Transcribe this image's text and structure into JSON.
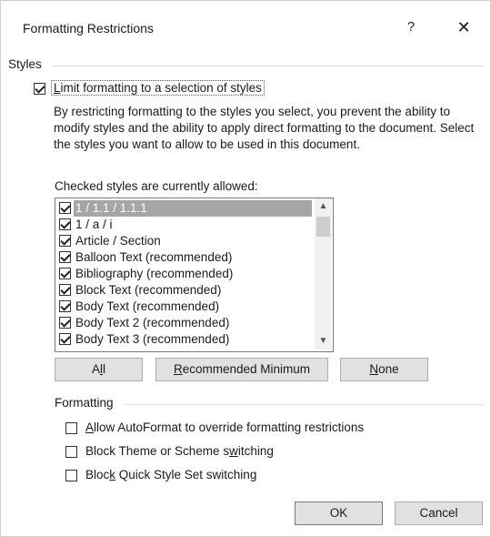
{
  "dialog": {
    "title": "Formatting Restrictions",
    "help_label": "?",
    "close_label": "✕"
  },
  "styles": {
    "group_label": "Styles",
    "limit_checkbox_checked": true,
    "limit_label_pre": "",
    "limit_label_accel": "L",
    "limit_label_post": "imit formatting to a selection of styles",
    "description": "By restricting formatting to the styles you select, you prevent the ability to modify styles and the ability to apply direct formatting to the document. Select the styles you want to allow to be used in this document.",
    "list_caption": "Checked styles are currently allowed:",
    "items": [
      {
        "label": "1 / 1.1 / 1.1.1",
        "checked": true
      },
      {
        "label": "1 / a / i",
        "checked": true
      },
      {
        "label": "Article / Section",
        "checked": true
      },
      {
        "label": "Balloon Text (recommended)",
        "checked": true
      },
      {
        "label": "Bibliography (recommended)",
        "checked": true
      },
      {
        "label": "Block Text (recommended)",
        "checked": true
      },
      {
        "label": "Body Text (recommended)",
        "checked": true
      },
      {
        "label": "Body Text 2 (recommended)",
        "checked": true
      },
      {
        "label": "Body Text 3 (recommended)",
        "checked": true
      }
    ],
    "selected_index": 0,
    "scroll_up_icon": "▲",
    "scroll_down_icon": "▼"
  },
  "buttons": {
    "all_pre": "A",
    "all_accel": "l",
    "all_post": "l",
    "recommended_pre": "",
    "recommended_accel": "R",
    "recommended_post": "ecommended Minimum",
    "none_pre": "",
    "none_accel": "N",
    "none_post": "one"
  },
  "formatting": {
    "group_label": "Formatting",
    "autoformat_checked": false,
    "autoformat_pre": "",
    "autoformat_accel": "A",
    "autoformat_post": "llow AutoFormat to override formatting restrictions",
    "theme_checked": false,
    "theme_pre": "Block Theme or Scheme s",
    "theme_accel": "w",
    "theme_post": "itching",
    "quickstyle_checked": false,
    "quickstyle_pre": "Bloc",
    "quickstyle_accel": "k",
    "quickstyle_post": " Quick Style Set switching"
  },
  "footer": {
    "ok_label": "OK",
    "cancel_label": "Cancel"
  }
}
